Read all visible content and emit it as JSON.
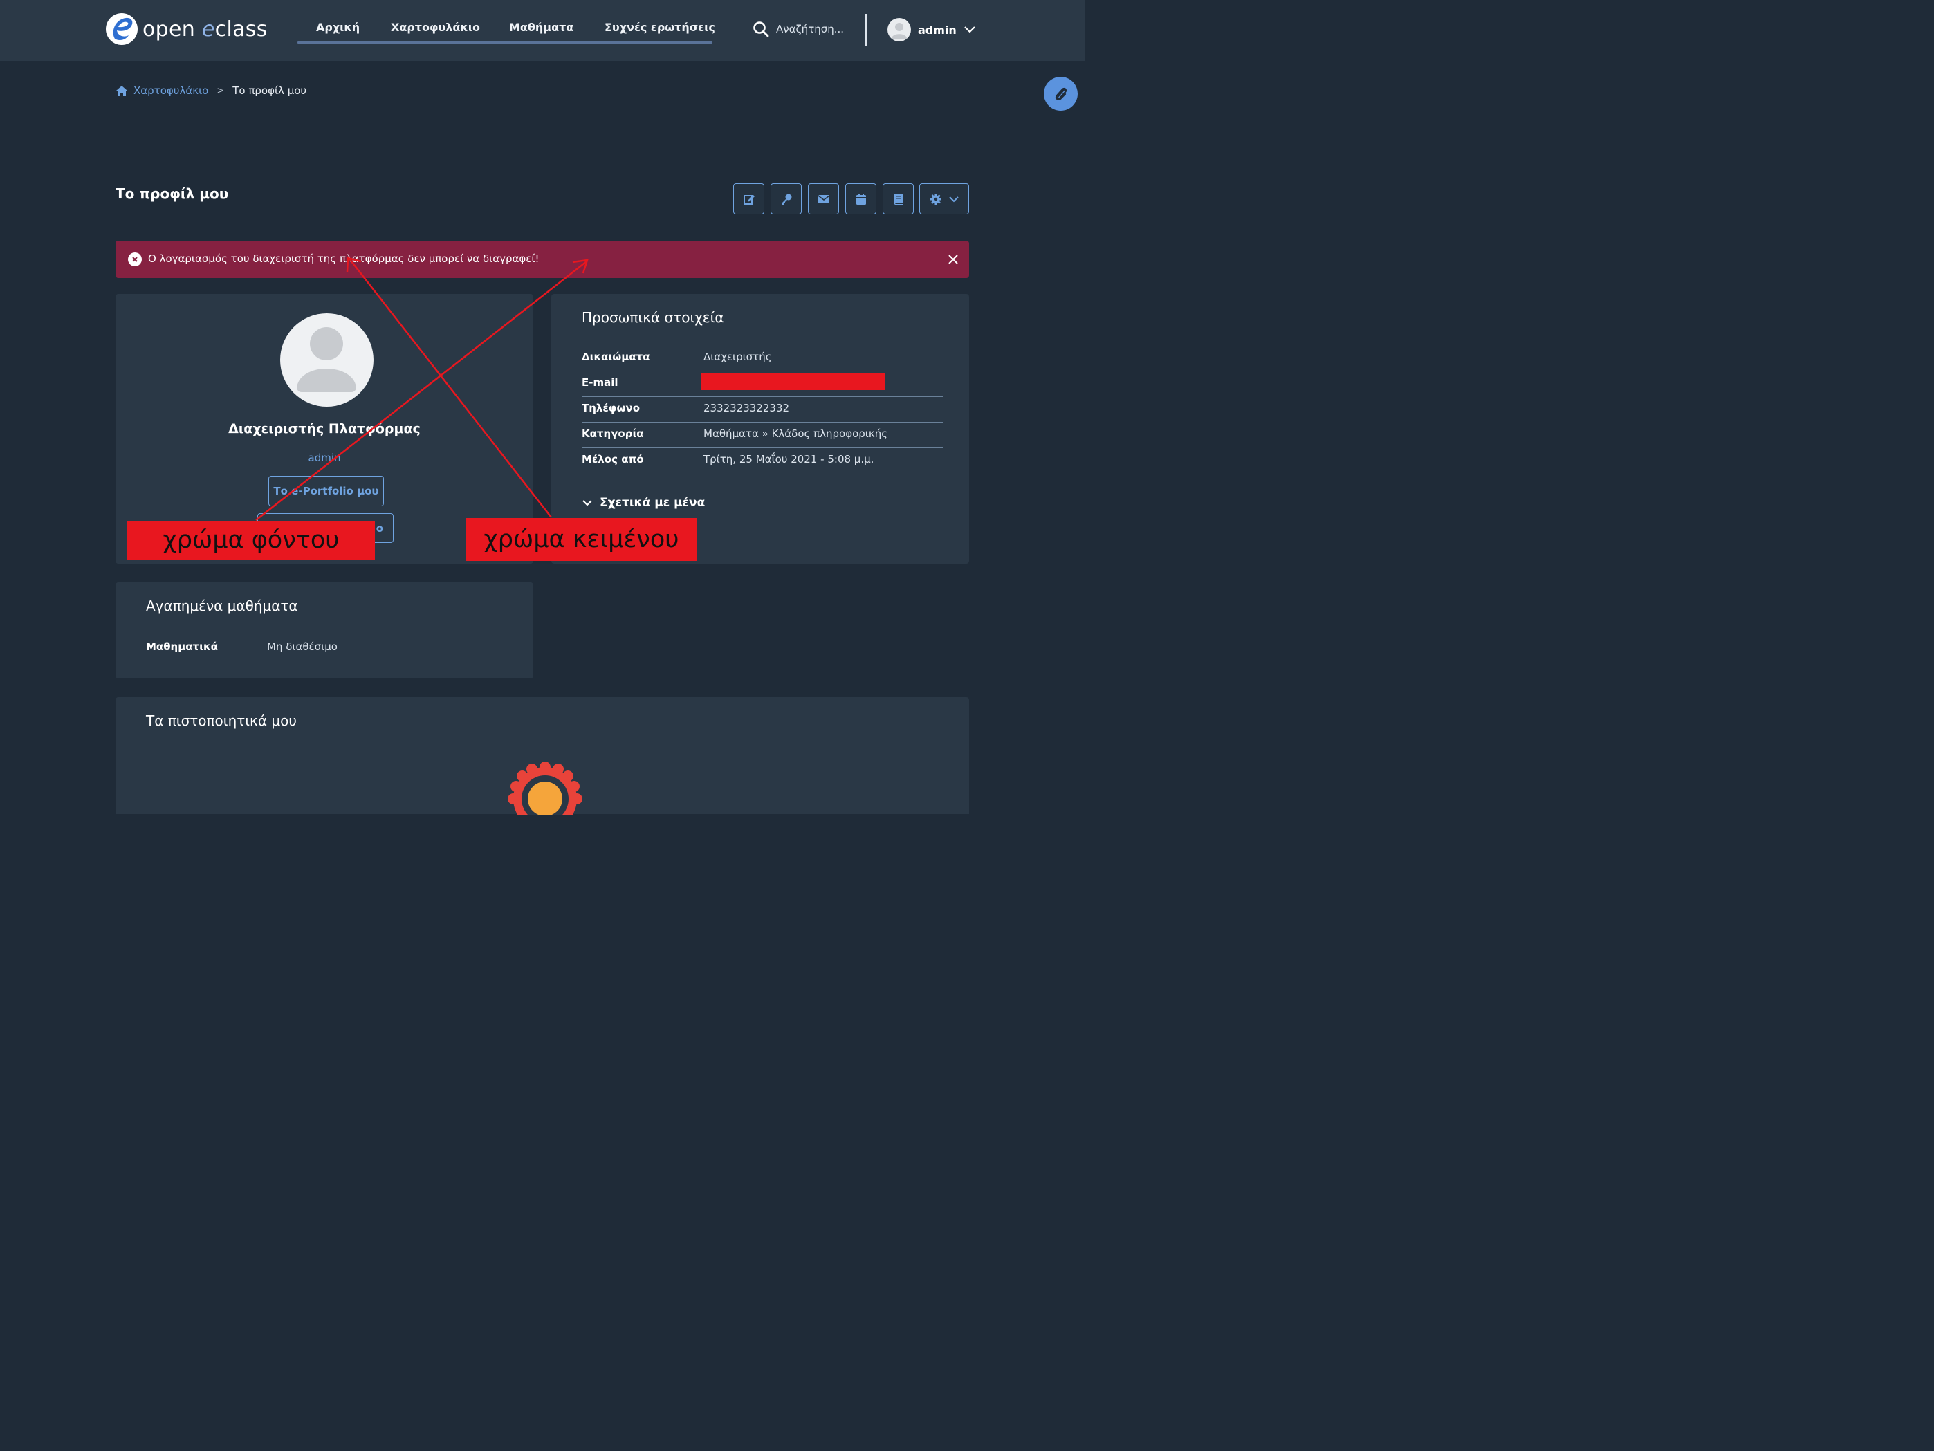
{
  "brand": {
    "name_prefix": "open ",
    "name_e": "e",
    "name_suffix": "class"
  },
  "nav": {
    "items": [
      "Αρχική",
      "Χαρτοφυλάκιο",
      "Μαθήματα",
      "Συχνές ερωτήσεις"
    ]
  },
  "search": {
    "placeholder": "Αναζήτηση..."
  },
  "user": {
    "name": "admin"
  },
  "breadcrumb": {
    "home": "Χαρτοφυλάκιο",
    "current": "Το προφίλ μου"
  },
  "page_title": "Το προφίλ μου",
  "toolbar": {
    "icons": [
      "edit-icon",
      "key-icon",
      "envelope-icon",
      "calendar-icon",
      "book-icon",
      "gear-icon"
    ]
  },
  "alert": {
    "text": "Ο λογαριασμός του διαχειριστή της πλατφόρμας δεν μπορεί να διαγραφεί!",
    "color": "#862141"
  },
  "profile": {
    "full_name": "Διαχειριστής Πλατφόρμας",
    "username": "admin",
    "portfolio_button": "Το e-Portfolio μου",
    "second_button": "ο"
  },
  "personal": {
    "title": "Προσωπικά στοιχεία",
    "rows": [
      {
        "label": "Δικαιώματα",
        "value": "Διαχειριστής"
      },
      {
        "label": "E-mail",
        "value": ""
      },
      {
        "label": "Τηλέφωνο",
        "value": "2332323322332"
      },
      {
        "label": "Κατηγορία",
        "value": "Μαθήματα » Κλάδος πληροφορικής"
      },
      {
        "label": "Μέλος από",
        "value": "Τρίτη, 25 Μαΐου 2021 - 5:08 μ.μ."
      }
    ],
    "about": "Σχετικά με μένα"
  },
  "favorites": {
    "title": "Αγαπημένα μαθήματα",
    "course": "Μαθηματικά",
    "status": "Μη διαθέσιμο"
  },
  "certificates": {
    "title": "Τα πιστοποιητικά μου"
  },
  "annotations": {
    "background": "χρώμα φόντου",
    "text": "χρώμα κειμένου"
  },
  "colors": {
    "page_bg": "#1f2b38",
    "header_bg": "#2b3947",
    "card_bg": "#2a3846",
    "accent": "#6fa3e0",
    "annotation_red": "#e8171f"
  }
}
